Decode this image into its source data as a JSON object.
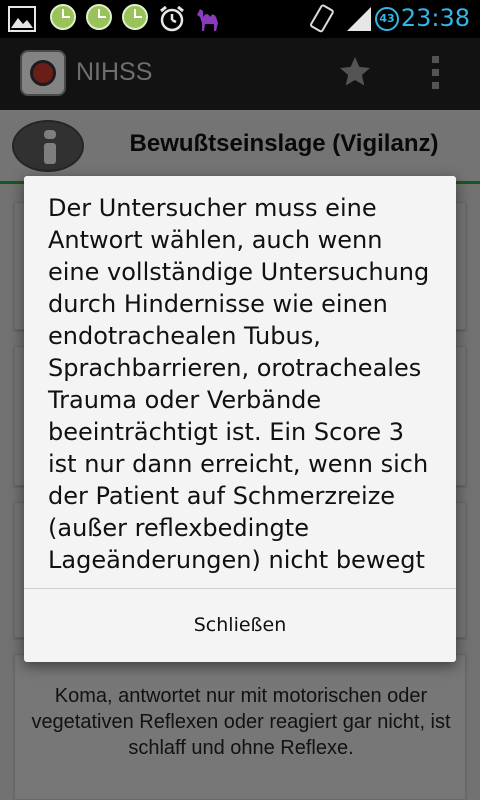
{
  "status_bar": {
    "time": "23:38",
    "battery_level": "43",
    "icons": [
      "image-icon",
      "clock-icon",
      "clock-icon",
      "clock-icon",
      "alarm-icon",
      "camel-icon",
      "rotate-icon",
      "signal-icon",
      "battery-icon"
    ]
  },
  "action_bar": {
    "title": "NIHSS",
    "icons": [
      "app-icon",
      "star-icon",
      "overflow-menu-icon"
    ]
  },
  "screen": {
    "section_title": "Bewußtseinslage (Vigilanz)",
    "options": [
      {
        "text": "Koma, antwortet nur mit motorischen oder vegetativen Reflexen oder reagiert gar nicht, ist schlaff und ohne Reflexe."
      }
    ]
  },
  "dialog": {
    "message": "Der Untersucher muss eine Antwort wählen, auch wenn eine vollständige Untersuchung durch Hindernisse wie einen endotrachealen Tubus, Sprachbarrieren, orotracheales Trauma oder Verbände beeinträchtigt ist. Ein Score 3 ist nur dann erreicht, wenn sich der Patient auf Schmerzreize (außer reflexbedingte Lageänderungen) nicht bewegt",
    "close_label": "Schließen"
  },
  "colors": {
    "accent_green": "#2e9e3e",
    "clock_blue": "#33b5e5",
    "overlay": "rgba(0,0,0,0.45)"
  }
}
